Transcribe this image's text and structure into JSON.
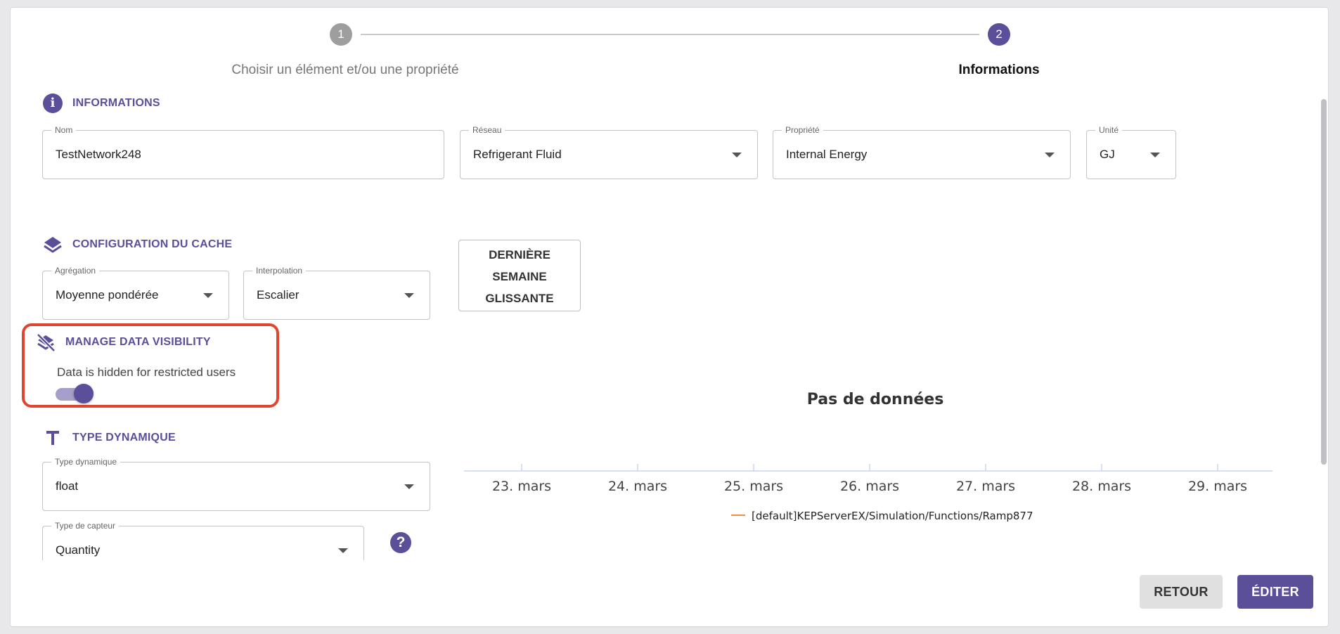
{
  "stepper": {
    "step1": {
      "number": "1",
      "label": "Choisir un élément et/ou une propriété"
    },
    "step2": {
      "number": "2",
      "label": "Informations"
    }
  },
  "informations": {
    "title": "INFORMATIONS",
    "nom": {
      "label": "Nom",
      "value": "TestNetwork248"
    },
    "reseau": {
      "label": "Réseau",
      "value": "Refrigerant Fluid"
    },
    "propriete": {
      "label": "Propriété",
      "value": "Internal Energy"
    },
    "unite": {
      "label": "Unité",
      "value": "GJ"
    }
  },
  "cache": {
    "title": "CONFIGURATION DU CACHE",
    "agregation": {
      "label": "Agrégation",
      "value": "Moyenne pondérée"
    },
    "interpolation": {
      "label": "Interpolation",
      "value": "Escalier"
    },
    "period_button": {
      "line1": "DERNIÈRE",
      "line2": "SEMAINE",
      "line3": "GLISSANTE"
    }
  },
  "visibility": {
    "title": "MANAGE DATA VISIBILITY",
    "text": "Data is hidden for restricted users",
    "toggle_on": true
  },
  "type_dynamique": {
    "title": "TYPE DYNAMIQUE",
    "type": {
      "label": "Type dynamique",
      "value": "float"
    },
    "capteur": {
      "label": "Type de capteur",
      "value": "Quantity"
    },
    "help_icon": "?"
  },
  "chart_data": {
    "type": "line",
    "no_data_text": "Pas de données",
    "categories": [
      "23. mars",
      "24. mars",
      "25. mars",
      "26. mars",
      "27. mars",
      "28. mars",
      "29. mars"
    ],
    "series": [
      {
        "name": "[default]KEPServerEX/Simulation/Functions/Ramp877",
        "color": "#f28f43",
        "values": []
      }
    ]
  },
  "footer": {
    "back_label": "RETOUR",
    "edit_label": "ÉDITER"
  },
  "colors": {
    "accent": "#5b4f9a",
    "highlight": "#e0452f"
  }
}
